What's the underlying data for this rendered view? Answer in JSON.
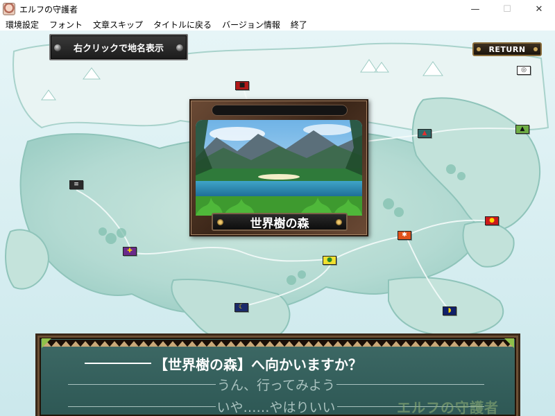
{
  "window": {
    "title": "エルフの守護者",
    "minimize_glyph": "—",
    "maximize_glyph": "☐",
    "close_glyph": "✕"
  },
  "menu": {
    "items": [
      "環境設定",
      "フォント",
      "文章スキップ",
      "タイトルに戻る",
      "バージョン情報",
      "終了"
    ]
  },
  "map": {
    "hint_text": "右クリックで地名表示",
    "return_label": "RETURN",
    "selected_location": "世界樹の森"
  },
  "flags": [
    {
      "id": "north-red",
      "color": "#b01818",
      "fg": "#1a1a1a",
      "glyph": "■"
    },
    {
      "id": "northeast-spiral",
      "color": "#ffffff",
      "fg": "#333333",
      "glyph": "◎"
    },
    {
      "id": "east-castle",
      "color": "#2f6a6a",
      "fg": "#e03030",
      "glyph": "▲"
    },
    {
      "id": "east-mountain",
      "color": "#6fae45",
      "fg": "#111111",
      "glyph": "▲"
    },
    {
      "id": "west-stripes",
      "color": "#2a2a2a",
      "fg": "#ffffff",
      "glyph": "≡"
    },
    {
      "id": "east-redwhite",
      "color": "#cc1a1a",
      "fg": "#ffd400",
      "glyph": "●"
    },
    {
      "id": "center-orange",
      "color": "#e0531a",
      "fg": "#ffffff",
      "glyph": "✱"
    },
    {
      "id": "west-purple",
      "color": "#6a2a8a",
      "fg": "#ffd400",
      "glyph": "✚"
    },
    {
      "id": "center-yellow",
      "color": "#f0e030",
      "fg": "#2a8a2a",
      "glyph": "●"
    },
    {
      "id": "south-moon",
      "color": "#1a2a6a",
      "fg": "#ffd400",
      "glyph": "☾"
    },
    {
      "id": "southeast-blue",
      "color": "#10206a",
      "fg": "#ffd400",
      "glyph": "◗"
    }
  ],
  "dialog": {
    "question": "【世界樹の森】へ向かいますか？",
    "choice_yes": "うん、行ってみよう",
    "choice_no": "いや……やはりいい",
    "watermark": "エルフの守護者"
  },
  "colors": {
    "map_sea": "#d7eef1",
    "map_land": "#b9ddd6",
    "dialog_bg": "#3e6a66",
    "frame_wood": "#4a3020",
    "choice_dim": "#a9c2bf"
  }
}
